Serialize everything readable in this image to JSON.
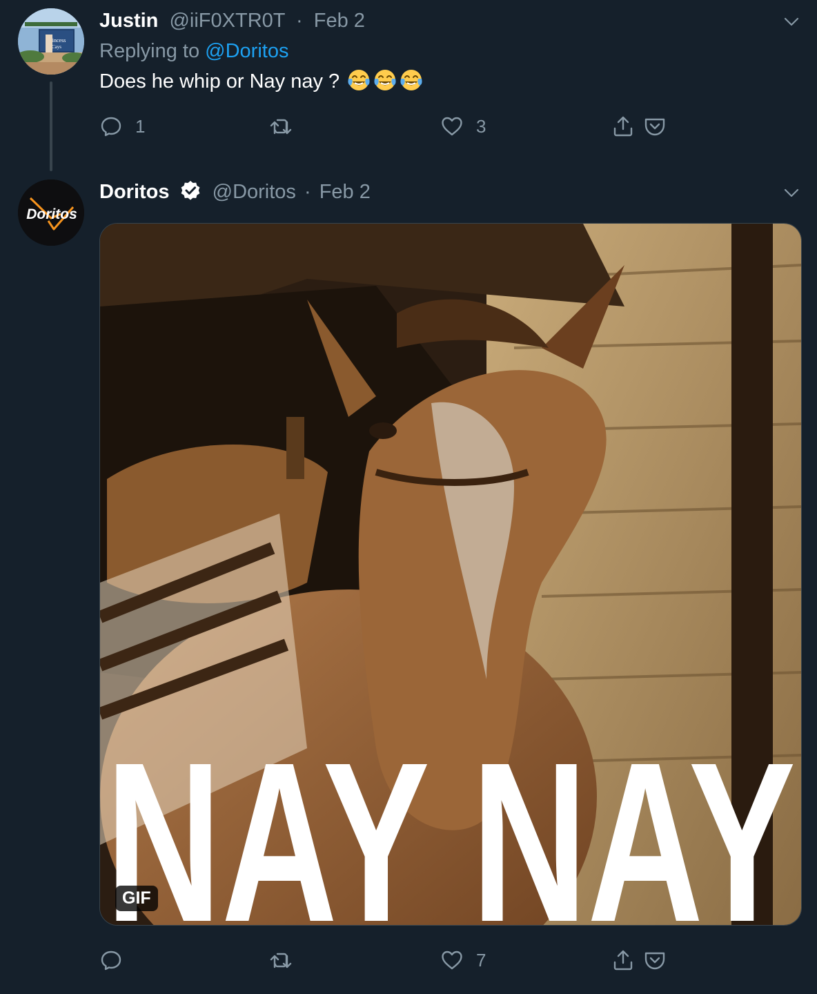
{
  "tweet1": {
    "name": "Justin",
    "handle": "@iiF0XTR0T",
    "separator": "·",
    "date": "Feb 2",
    "replying_prefix": "Replying to",
    "replying_handle": "@Doritos",
    "text": "Does he whip or Nay nay ?",
    "emojis": [
      "face-with-tears-of-joy",
      "face-with-tears-of-joy",
      "face-with-tears-of-joy"
    ],
    "avatar_sign_text": [
      "Princess",
      "Cays"
    ],
    "actions": {
      "reply_count": "1",
      "retweet_count": "",
      "like_count": "3"
    }
  },
  "tweet2": {
    "name": "Doritos",
    "verified": true,
    "handle": "@Doritos",
    "separator": "·",
    "date": "Feb 2",
    "avatar_logo_text": "Doritos",
    "media": {
      "type": "gif",
      "overlay_text": "NAY NAY",
      "badge": "GIF"
    },
    "actions": {
      "reply_count": "",
      "retweet_count": "",
      "like_count": "7"
    }
  },
  "colors": {
    "background": "#15202b",
    "muted": "#8899a6",
    "link": "#1da1f2",
    "thread_line": "#38444d",
    "doritos_orange": "#f7941d"
  }
}
